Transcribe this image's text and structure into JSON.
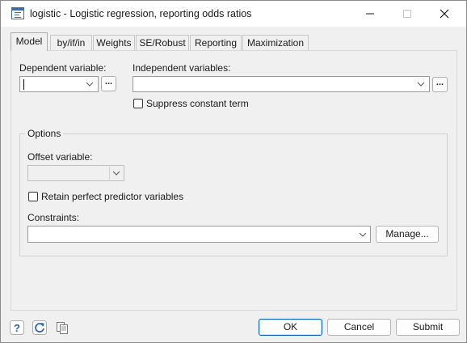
{
  "window": {
    "title": "logistic - Logistic regression, reporting odds ratios",
    "icons": [
      "app-icon",
      "minimize-icon",
      "maximize-icon",
      "close-icon"
    ]
  },
  "tabs": [
    {
      "label": "Model",
      "active": true
    },
    {
      "label": "by/if/in",
      "active": false
    },
    {
      "label": "Weights",
      "active": false
    },
    {
      "label": "SE/Robust",
      "active": false
    },
    {
      "label": "Reporting",
      "active": false
    },
    {
      "label": "Maximization",
      "active": false
    }
  ],
  "model": {
    "dependent_label": "Dependent variable:",
    "dependent_value": "",
    "independent_label": "Independent variables:",
    "independent_value": "",
    "browse_label": "...",
    "suppress_constant_label": "Suppress constant term",
    "suppress_constant_checked": false
  },
  "options": {
    "legend": "Options",
    "offset_label": "Offset variable:",
    "offset_value": "",
    "retain_label": "Retain perfect predictor variables",
    "retain_checked": false,
    "constraints_label": "Constraints:",
    "constraints_value": "",
    "manage_label": "Manage..."
  },
  "footer": {
    "icons": [
      "help-icon",
      "reset-icon",
      "copy-icon"
    ],
    "ok_label": "OK",
    "cancel_label": "Cancel",
    "submit_label": "Submit"
  },
  "colors": {
    "dialog_bg": "#f0f0f0",
    "titlebar_bg": "#ffffff",
    "accent": "#005fb8",
    "icon_blue": "#3a6ea5"
  }
}
